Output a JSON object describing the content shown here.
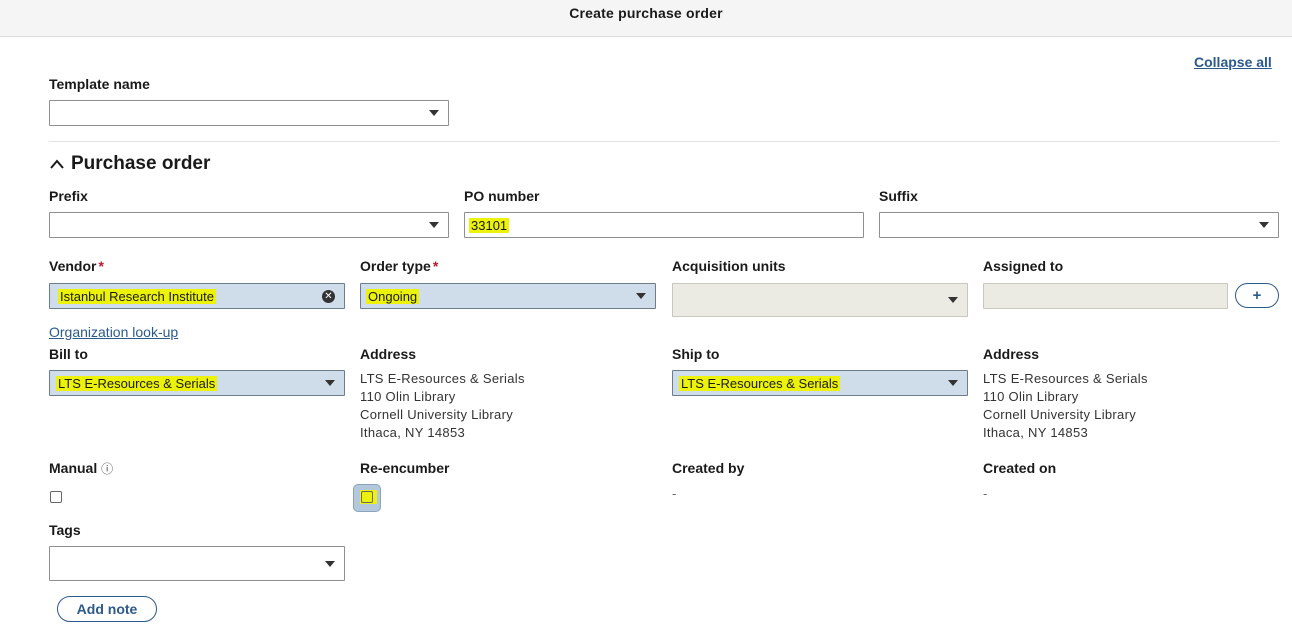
{
  "header": {
    "title": "Create purchase order"
  },
  "collapse_all": "Collapse all",
  "template": {
    "label": "Template name",
    "value": ""
  },
  "section": {
    "title": "Purchase order"
  },
  "prefix": {
    "label": "Prefix",
    "value": ""
  },
  "po_number": {
    "label": "PO number",
    "value": "33101"
  },
  "suffix": {
    "label": "Suffix",
    "value": ""
  },
  "vendor": {
    "label": "Vendor",
    "required": "*",
    "value": "Istanbul Research Institute"
  },
  "order_type": {
    "label": "Order type",
    "required": "*",
    "value": "Ongoing"
  },
  "acquisition_units": {
    "label": "Acquisition units",
    "value": ""
  },
  "assigned_to": {
    "label": "Assigned to",
    "value": "",
    "add_symbol": "+"
  },
  "org_lookup": "Organization look-up",
  "bill_to": {
    "label": "Bill to",
    "value": "LTS E-Resources & Serials"
  },
  "bill_address": {
    "label": "Address",
    "lines": [
      "LTS E-Resources & Serials",
      "110 Olin Library",
      "Cornell University Library",
      "Ithaca, NY 14853"
    ]
  },
  "ship_to": {
    "label": "Ship to",
    "value": "LTS E-Resources & Serials"
  },
  "ship_address": {
    "label": "Address",
    "lines": [
      "LTS E-Resources & Serials",
      "110 Olin Library",
      "Cornell University Library",
      "Ithaca, NY 14853"
    ]
  },
  "manual": {
    "label": "Manual",
    "info_symbol": "ⓘ",
    "checked": false
  },
  "re_encumber": {
    "label": "Re-encumber",
    "checked": false
  },
  "created_by": {
    "label": "Created by",
    "value": "-"
  },
  "created_on": {
    "label": "Created on",
    "value": "-"
  },
  "tags": {
    "label": "Tags",
    "value": ""
  },
  "add_note": "Add note",
  "colors": {
    "accent": "#2b5a8c",
    "required": "#c0172d",
    "highlight": "#ecf20a",
    "filled": "#cfdce9"
  }
}
